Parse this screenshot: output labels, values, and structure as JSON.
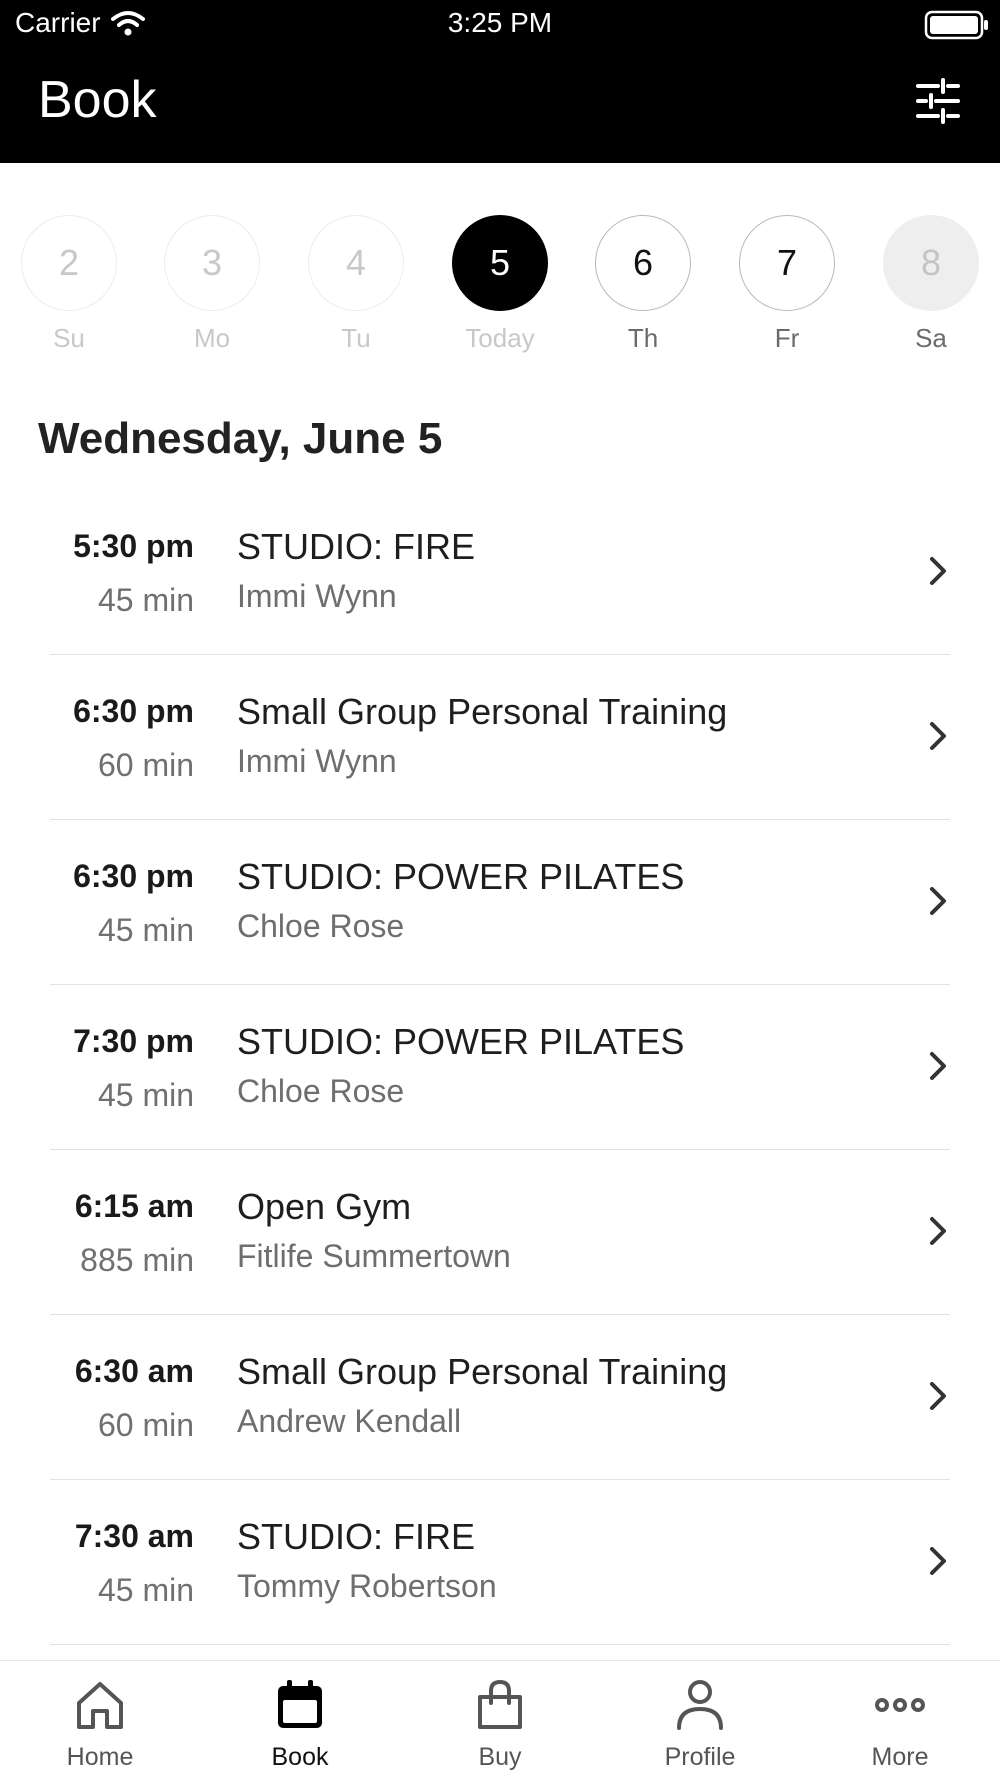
{
  "status_bar": {
    "carrier": "Carrier",
    "time": "3:25 PM"
  },
  "header": {
    "title": "Book",
    "filter_icon": "sliders-icon"
  },
  "days": [
    {
      "number": "2",
      "label": "Su",
      "state": "past"
    },
    {
      "number": "3",
      "label": "Mo",
      "state": "past"
    },
    {
      "number": "4",
      "label": "Tu",
      "state": "past"
    },
    {
      "number": "5",
      "label": "Today",
      "state": "selected"
    },
    {
      "number": "6",
      "label": "Th",
      "state": "future"
    },
    {
      "number": "7",
      "label": "Fr",
      "state": "future"
    },
    {
      "number": "8",
      "label": "Sa",
      "state": "unavailable"
    }
  ],
  "date_heading": "Wednesday, June 5",
  "classes": [
    {
      "time": "5:30 pm",
      "duration": "45 min",
      "name": "STUDIO: FIRE",
      "instructor": "Immi Wynn"
    },
    {
      "time": "6:30 pm",
      "duration": "60 min",
      "name": "Small Group Personal Training",
      "instructor": "Immi Wynn"
    },
    {
      "time": "6:30 pm",
      "duration": "45 min",
      "name": "STUDIO: POWER PILATES",
      "instructor": "Chloe Rose"
    },
    {
      "time": "7:30 pm",
      "duration": "45 min",
      "name": "STUDIO: POWER PILATES",
      "instructor": "Chloe Rose"
    },
    {
      "time": "6:15 am",
      "duration": "885 min",
      "name": "Open Gym",
      "instructor": "Fitlife Summertown"
    },
    {
      "time": "6:30 am",
      "duration": "60 min",
      "name": "Small Group Personal Training",
      "instructor": "Andrew Kendall"
    },
    {
      "time": "7:30 am",
      "duration": "45 min",
      "name": "STUDIO: FIRE",
      "instructor": "Tommy Robertson"
    }
  ],
  "tabs": [
    {
      "label": "Home",
      "icon": "home-icon",
      "active": false
    },
    {
      "label": "Book",
      "icon": "calendar-icon",
      "active": true
    },
    {
      "label": "Buy",
      "icon": "shopping-bag-icon",
      "active": false
    },
    {
      "label": "Profile",
      "icon": "person-icon",
      "active": false
    },
    {
      "label": "More",
      "icon": "more-icon",
      "active": false
    }
  ],
  "colors": {
    "header_bg": "#000000",
    "accent": "#000000",
    "muted_text": "#6e6e6e"
  }
}
